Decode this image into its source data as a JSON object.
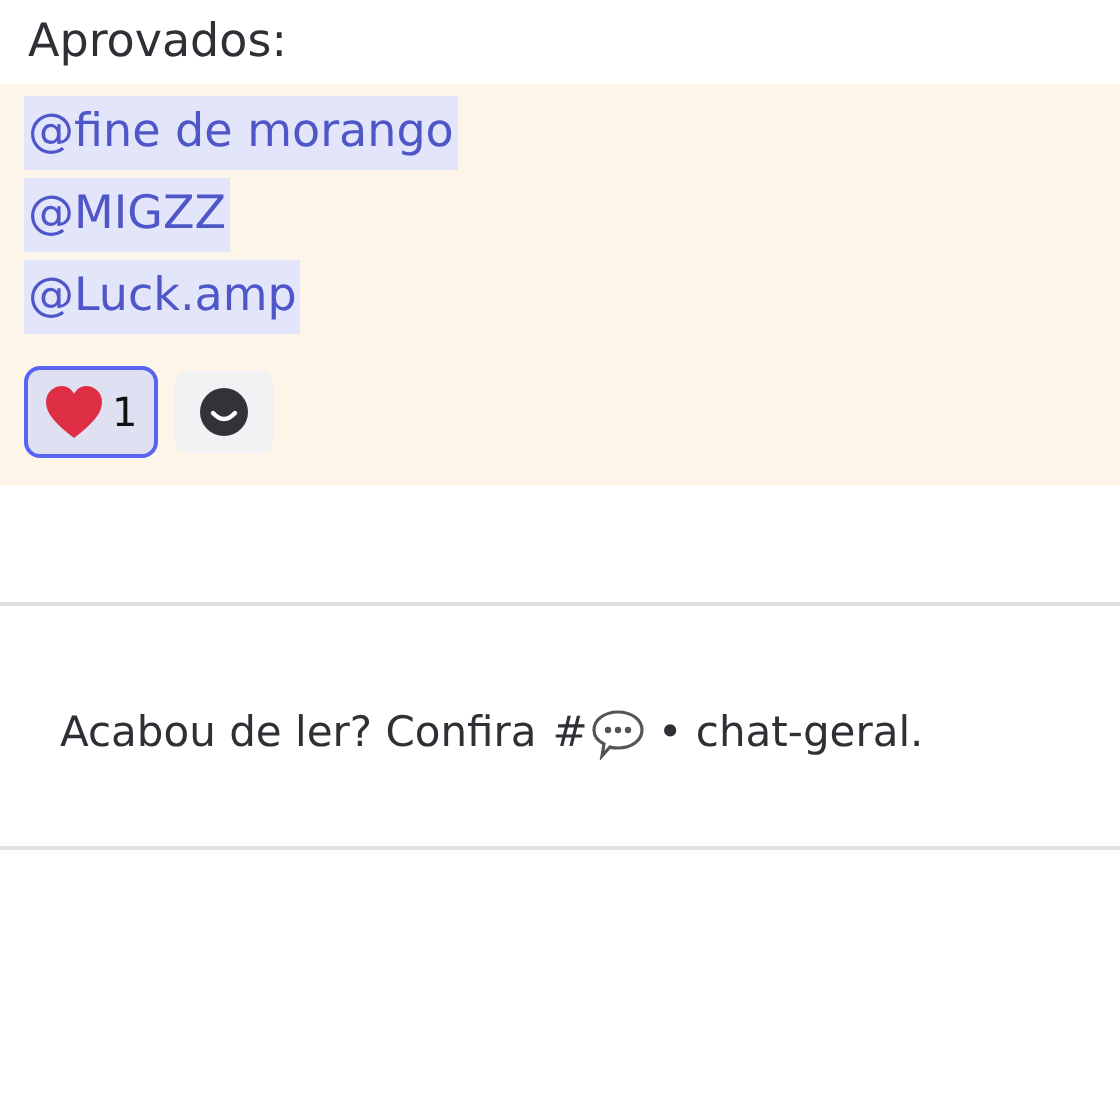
{
  "heading": "Aprovados:",
  "mentions": [
    "@fine de morango",
    "@MIGZZ",
    "@Luck.amp"
  ],
  "reactions": [
    {
      "kind": "heart",
      "count": "1",
      "selected": true
    }
  ],
  "footer": {
    "intro": "Acabou de ler? Confira",
    "channel_prefix": "#",
    "channel_name": "• chat-geral."
  }
}
